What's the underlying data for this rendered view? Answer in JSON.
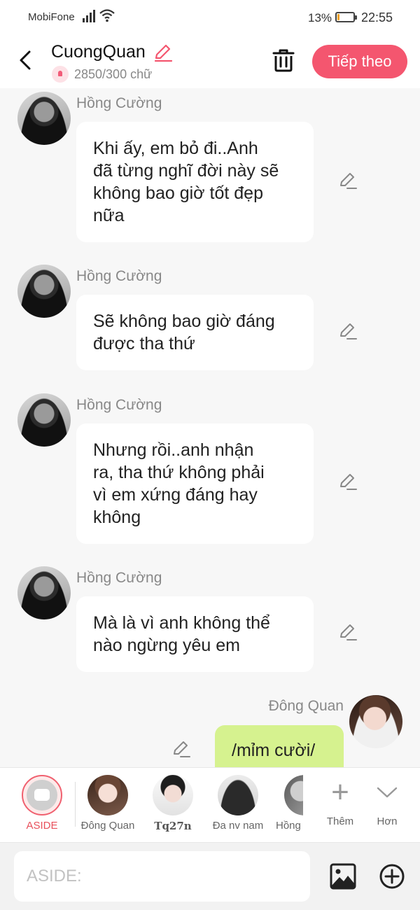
{
  "status_bar": {
    "carrier": "MobiFone",
    "battery_percent": "13%",
    "battery_level": 0.13,
    "time": "22:55"
  },
  "header": {
    "title": "CuongQuan",
    "word_count": "2850/300 chữ",
    "next_label": "Tiếp theo"
  },
  "messages": [
    {
      "sender": "Hồng Cường",
      "lines": [
        "Khi ấy, em bỏ đi..Anh",
        "đã từng nghĩ đời này sẽ",
        "không bao giờ tốt đẹp",
        "nữa"
      ]
    },
    {
      "sender": "Hồng Cường",
      "lines": [
        "Sẽ không bao giờ đáng",
        "được tha thứ"
      ]
    },
    {
      "sender": "Hồng Cường",
      "lines": [
        "Nhưng rồi..anh nhận",
        "ra, tha thứ không phải",
        "vì em xứng đáng hay",
        "không"
      ]
    },
    {
      "sender": "Hồng Cường",
      "lines": [
        "Mà là vì anh không thể",
        "nào ngừng yêu em"
      ]
    },
    {
      "sender": "Đông Quan",
      "lines": [
        "/mỉm cười/"
      ]
    }
  ],
  "characters": [
    {
      "name": "ASIDE"
    },
    {
      "name": "Đông Quan"
    },
    {
      "name": "Tq27n"
    },
    {
      "name": "Đa nv nam"
    },
    {
      "name": "Hồng"
    },
    {
      "name": "Thêm"
    },
    {
      "name": "Hơn"
    }
  ],
  "input": {
    "placeholder": "ASIDE:"
  },
  "colors": {
    "accent": "#f4566f",
    "aside_active": "#e8505b",
    "outgoing_bubble": "#d6f28f",
    "battery_warning": "#f0a020"
  }
}
